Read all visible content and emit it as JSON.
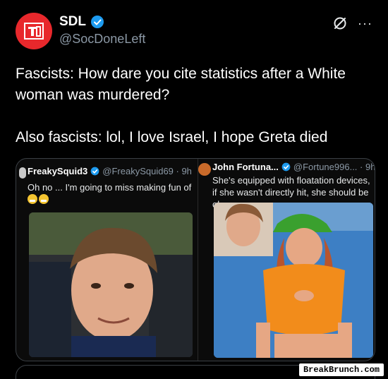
{
  "author": {
    "name": "SDL",
    "handle": "@SocDoneLeft",
    "verified": true,
    "avatar_color": "#e8282c",
    "avatar_icon": "sdl-logo-icon"
  },
  "header_icons": [
    "grok-icon",
    "more-icon"
  ],
  "more_label": "···",
  "tweet": {
    "line1": "Fascists: How dare you cite statistics after a White",
    "line2": "woman was murdered?",
    "line3": "Also fascists: lol, I love Israel, I hope Greta died"
  },
  "quoted_left": {
    "name": "FreakySquid3",
    "handle": "@FreakySquid69 · 9h",
    "text": "Oh no ... I'm going to miss making fun of"
  },
  "quoted_right": {
    "name": "John Fortuna...",
    "handle": "@Fortune996... · 9h",
    "text": "She's equipped with floatation devices, if she wasn't directly hit, she should be ok."
  },
  "watermark": "BreakBrunch.com",
  "colors": {
    "verified": "#1d9bf0",
    "muted": "#8b98a5",
    "background": "#000000"
  }
}
